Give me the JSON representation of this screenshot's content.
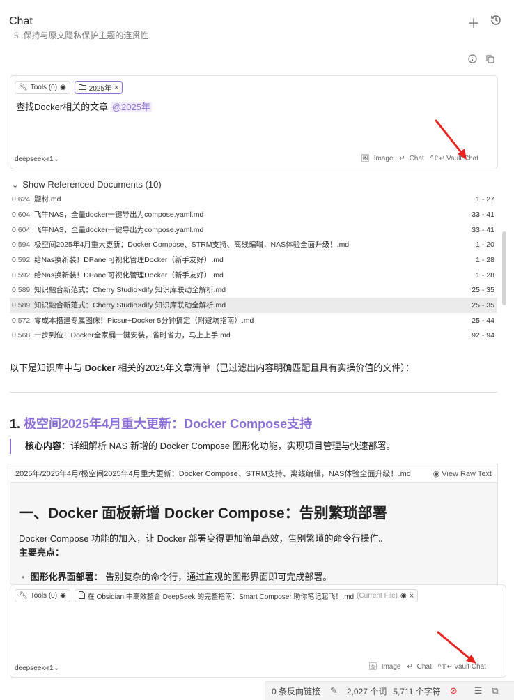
{
  "header": {
    "title": "Chat",
    "faded_number": "5.",
    "faded_line": "保持与原文隐私保护主题的连贯性"
  },
  "composer_top": {
    "tools_chip": "Tools (0)",
    "folder_chip": "2025年",
    "prompt": "查找Docker相关的文章",
    "mention": "@2025年",
    "model": "deepseek-r1",
    "image_label": "Image",
    "chat_label": "Chat",
    "vault_chat_label": "Vault Chat"
  },
  "references": {
    "toggle": "Show Referenced Documents (10)",
    "rows": [
      {
        "score": "0.624",
        "name": "题材.md",
        "range": "1 - 27"
      },
      {
        "score": "0.604",
        "name": "飞牛NAS，全量docker一键导出为compose.yaml.md",
        "range": "33 - 41"
      },
      {
        "score": "0.604",
        "name": "飞牛NAS，全量docker一键导出为compose.yaml.md",
        "range": "33 - 41"
      },
      {
        "score": "0.594",
        "name": "极空间2025年4月重大更新：Docker Compose、STRM支持、离线编辑，NAS体验全面升级！.md",
        "range": "1 - 20"
      },
      {
        "score": "0.592",
        "name": "给Nas换新装！DPanel可视化管理Docker（新手友好）.md",
        "range": "1 - 28"
      },
      {
        "score": "0.592",
        "name": "给Nas换新装！DPanel可视化管理Docker（新手友好）.md",
        "range": "1 - 28"
      },
      {
        "score": "0.589",
        "name": "知识融合新范式：Cherry Studio×dify 知识库联动全解析.md",
        "range": "25 - 35"
      },
      {
        "score": "0.589",
        "name": "知识融合新范式：Cherry Studio×dify 知识库联动全解析.md",
        "range": "25 - 35"
      },
      {
        "score": "0.572",
        "name": "零成本搭建专属图床！Picsur+Docker 5分钟搞定（附避坑指南）.md",
        "range": "25 - 44"
      },
      {
        "score": "0.568",
        "name": "一步到位！Docker全家桶一键安装，省时省力，马上上手.md",
        "range": "92 - 94"
      }
    ]
  },
  "answer": {
    "intro_pre": "以下是知识库中与 ",
    "intro_bold": "Docker",
    "intro_post": " 相关的2025年文章清单（已过滤出内容明确匹配且具有实操价值的文件）：",
    "item_number": "1.",
    "item_link": "极空间2025年4月重大更新：Docker Compose支持",
    "quote_label": "核心内容",
    "quote_text": "：详细解析 NAS 新增的 Docker Compose 图形化功能，实现项目管理与快速部署。",
    "embed_path": "2025年/2025年4月/极空间2025年4月重大更新：Docker Compose、STRM支持、离线编辑，NAS体验全面升级！.md",
    "view_raw": "View Raw Text",
    "embed_heading": "一、Docker 面板新增 Docker Compose：告别繁琐部署",
    "embed_para": "Docker Compose 功能的加入，让 Docker 部署变得更加简单高效，告别繁琐的命令行操作。",
    "embed_highlights": "主要亮点：",
    "embed_bullet_bold": "图形化界面部署：",
    "embed_bullet_text": " 告别复杂的命令行，通过直观的图形界面即可完成部署。"
  },
  "composer_bottom": {
    "tools_chip": "Tools (0)",
    "file_chip": "在 Obsidian 中高效整合 DeepSeek 的完整指南：Smart Composer 助你笔记起飞！.md",
    "current_file": "(Current File)",
    "model": "deepseek-r1",
    "image_label": "Image",
    "chat_label": "Chat",
    "vault_chat_label": "Vault Chat"
  },
  "status_bar": {
    "backlinks": "0 条反向链接",
    "words": "2,027 个词",
    "chars": "5,711 个字符"
  },
  "colors": {
    "accent": "#8b6fd6",
    "arrow": "#e8231f"
  }
}
